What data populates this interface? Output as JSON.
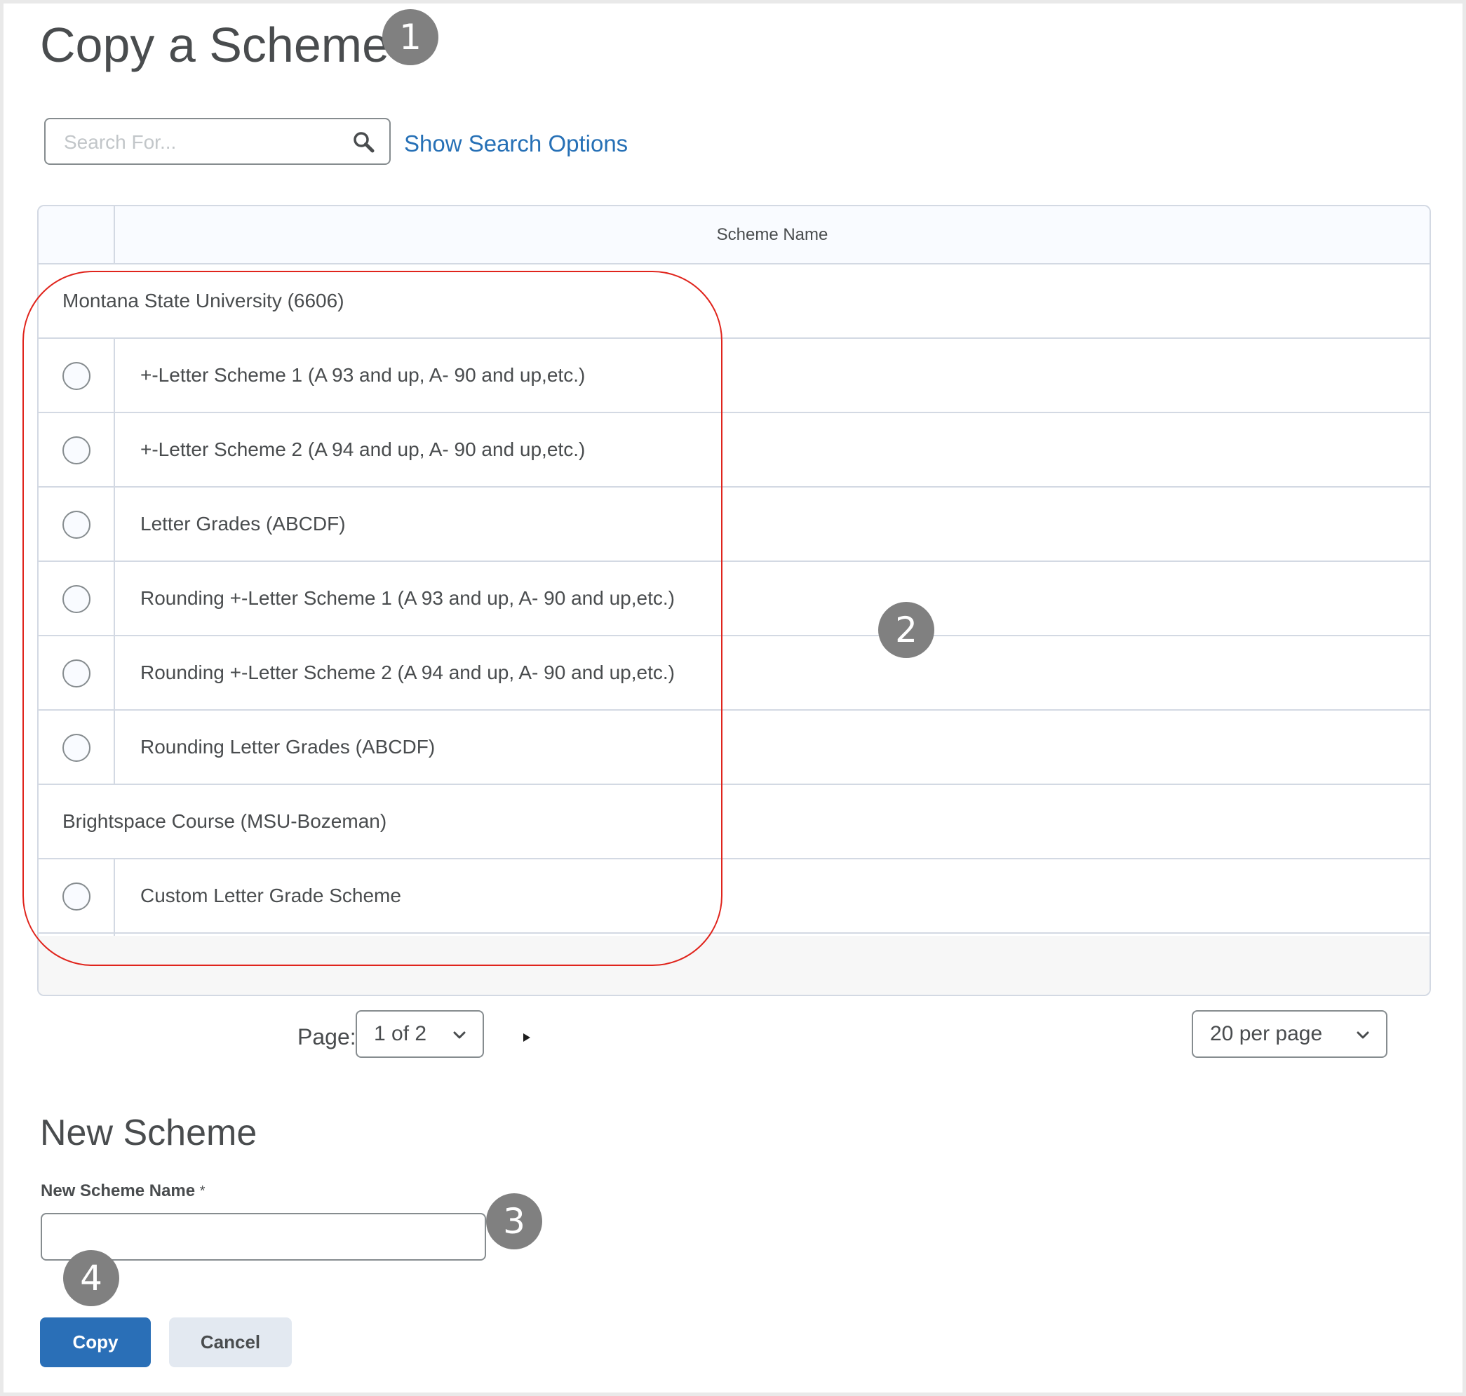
{
  "page": {
    "title": "Copy a Scheme"
  },
  "search": {
    "placeholder": "Search For...",
    "value": "",
    "icon": "search-icon",
    "show_options_label": "Show Search Options"
  },
  "table": {
    "header": {
      "scheme_name": "Scheme Name"
    },
    "groups": [
      {
        "label": "Montana State University (6606)",
        "rows": [
          {
            "name": "+-Letter Scheme 1 (A 93 and up, A- 90 and up,etc.)",
            "selected": false
          },
          {
            "name": "+-Letter Scheme 2 (A 94 and up, A- 90 and up,etc.)",
            "selected": false
          },
          {
            "name": "Letter Grades (ABCDF)",
            "selected": false
          },
          {
            "name": "Rounding +-Letter Scheme 1 (A 93 and up, A- 90 and up,etc.)",
            "selected": false
          },
          {
            "name": "Rounding +-Letter Scheme 2 (A 94 and up, A- 90 and up,etc.)",
            "selected": false
          },
          {
            "name": "Rounding Letter Grades (ABCDF)",
            "selected": false
          }
        ]
      },
      {
        "label": "Brightspace Course (MSU-Bozeman)",
        "rows": [
          {
            "name": "Custom Letter Grade Scheme",
            "selected": false
          }
        ]
      }
    ]
  },
  "pagination": {
    "page_label": "Page:",
    "current_page": "1 of 2",
    "next_icon": "play-arrow-icon",
    "per_page": "20 per page"
  },
  "new_scheme": {
    "heading": "New Scheme",
    "name_label": "New Scheme Name",
    "required_marker": "*",
    "name_value": ""
  },
  "buttons": {
    "copy": "Copy",
    "cancel": "Cancel"
  },
  "callouts": [
    "1",
    "2",
    "3",
    "4"
  ],
  "colors": {
    "primary": "#2a6fb7",
    "link": "#2670b6",
    "callout_badge": "#808080",
    "callout_outline": "#e0241c",
    "text": "#494c4e",
    "border": "#d3d9e3"
  }
}
